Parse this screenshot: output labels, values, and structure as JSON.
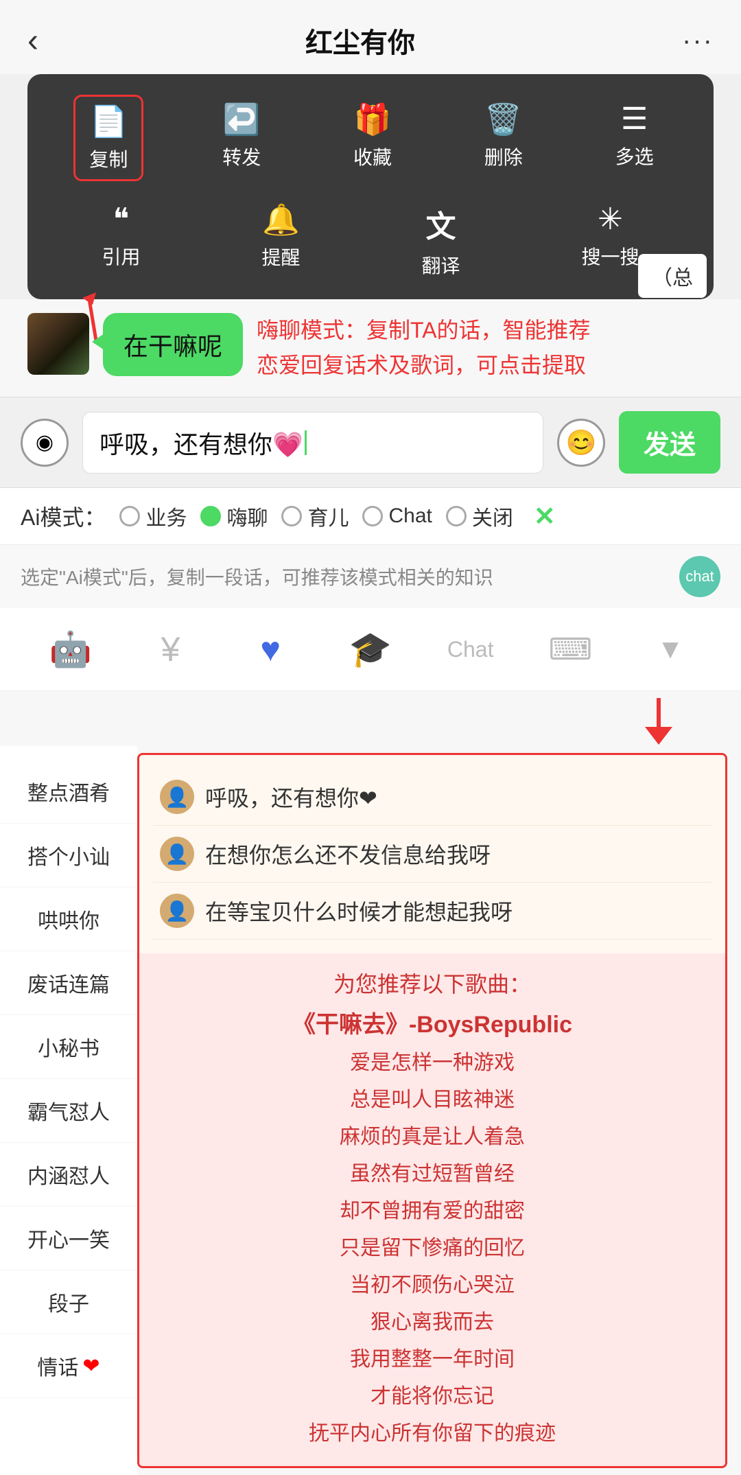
{
  "header": {
    "back_icon": "‹",
    "title": "红尘有你",
    "more_icon": "···"
  },
  "context_menu": {
    "items_row1": [
      {
        "icon": "📋",
        "label": "复制",
        "highlighted": true
      },
      {
        "icon": "↩",
        "label": "转发"
      },
      {
        "icon": "🎁",
        "label": "收藏"
      },
      {
        "icon": "🗑",
        "label": "删除"
      },
      {
        "icon": "☰",
        "label": "多选"
      }
    ],
    "items_row2": [
      {
        "icon": "❝",
        "label": "引用"
      },
      {
        "icon": "🔔",
        "label": "提醒"
      },
      {
        "icon": "翻",
        "label": "翻译"
      },
      {
        "icon": "✳",
        "label": "搜一搜"
      }
    ]
  },
  "annotation": {
    "text": "嗨聊模式：复制TA的话，智能推荐\n恋爱回复话术及歌词，可点击提取"
  },
  "chat_bubble": {
    "text": "在干嘛呢"
  },
  "input_bar": {
    "text": "呼吸，还有想你💗",
    "send_label": "发送",
    "emoji_icon": "😊",
    "voice_icon": "◉"
  },
  "ai_modes": {
    "label": "Ai模式：",
    "options": [
      {
        "id": "yewu",
        "label": "业务",
        "active": false
      },
      {
        "id": "haijiao",
        "label": "嗨聊",
        "active": true
      },
      {
        "id": "yuer",
        "label": "育儿",
        "active": false
      },
      {
        "id": "chat",
        "label": "Chat",
        "active": false
      },
      {
        "id": "guanbi",
        "label": "关闭",
        "active": false
      }
    ],
    "close_icon": "✕"
  },
  "hint_bar": {
    "text": "选定\"Ai模式\"后，复制一段话，可推荐该模式相关的知识"
  },
  "toolbar": {
    "items": [
      {
        "name": "chat-robot",
        "icon": "🤖",
        "active": true
      },
      {
        "name": "payment",
        "icon": "¥",
        "active": false
      },
      {
        "name": "heart",
        "icon": "♥",
        "active": false
      },
      {
        "name": "graduation",
        "icon": "🎓",
        "active": false
      },
      {
        "name": "chat-text",
        "label": "Chat",
        "active": false
      },
      {
        "name": "keyboard",
        "icon": "⌨",
        "active": false
      },
      {
        "name": "dropdown",
        "icon": "▼",
        "active": false
      }
    ]
  },
  "sidebar": {
    "items": [
      {
        "label": "整点酒肴"
      },
      {
        "label": "搭个小讪"
      },
      {
        "label": "哄哄你"
      },
      {
        "label": "废话连篇"
      },
      {
        "label": "小秘书"
      },
      {
        "label": "霸气怼人"
      },
      {
        "label": "内涵怼人"
      },
      {
        "label": "开心一笑"
      },
      {
        "label": "段子"
      },
      {
        "label": "情话",
        "heart": true
      }
    ]
  },
  "reply_suggestions": {
    "items": [
      {
        "text": "呼吸，还有想你❤"
      },
      {
        "text": "在想你怎么还不发信息给我呀"
      },
      {
        "text": "在等宝贝什么时候才能想起我呀"
      }
    ]
  },
  "song_section": {
    "title": "为您推荐以下歌曲：",
    "song_name": "《干嘛去》-BoysRepublic",
    "lyrics": [
      "爱是怎样一种游戏",
      "总是叫人目眩神迷",
      "麻烦的真是让人着急",
      "虽然有过短暂曾经",
      "却不曾拥有爱的甜密",
      "只是留下惨痛的回忆",
      "当初不顾伤心哭泣",
      "狠心离我而去",
      "我用整整一年时间",
      "才能将你忘记",
      "抚平内心所有你留下的痕迹"
    ]
  }
}
